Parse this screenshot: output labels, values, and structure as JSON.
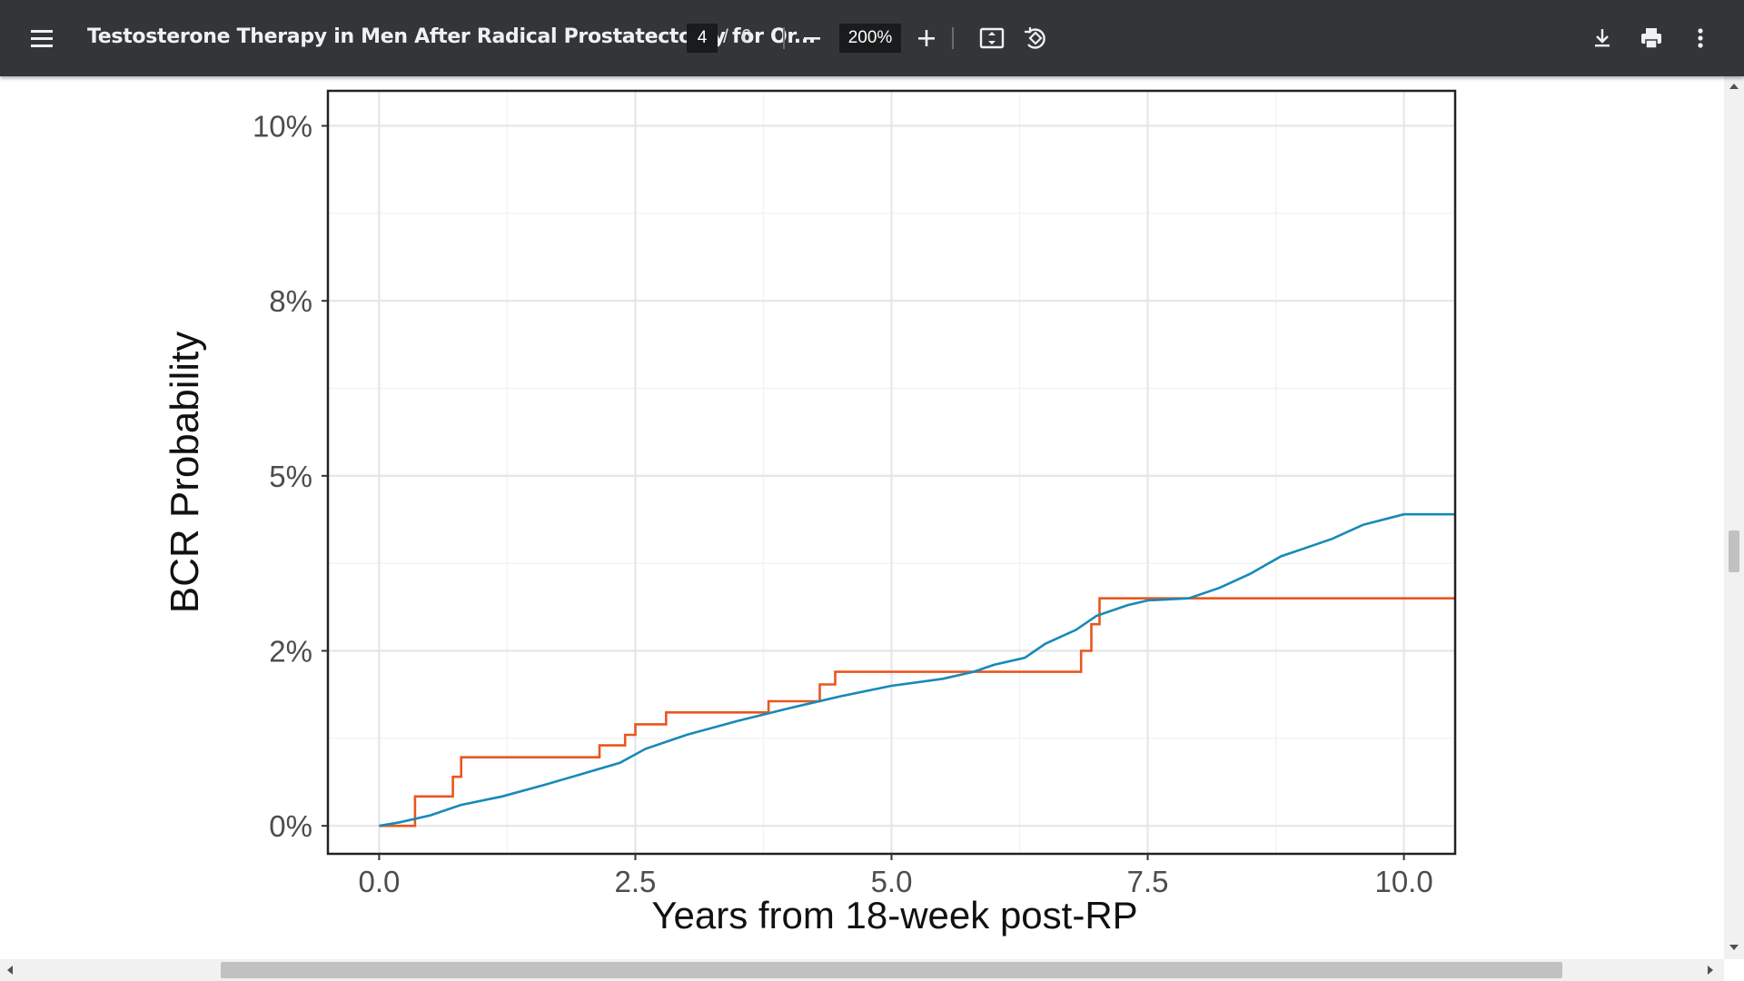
{
  "toolbar": {
    "menu_icon": "hamburger-menu-icon",
    "title": "Testosterone Therapy in Men After Radical Prostatectomy for Or...",
    "page_current": "4",
    "page_separator": "/",
    "page_total": "6",
    "zoom": "200%",
    "icons": [
      "zoom-out-icon",
      "zoom-in-icon",
      "fit-page-icon",
      "rotate-icon",
      "download-icon",
      "print-icon",
      "more-options-icon"
    ]
  },
  "chart_data": {
    "type": "line",
    "title": "",
    "xlabel": "Years from 18-week post-RP",
    "ylabel": "BCR Probability",
    "xlim": [
      -0.5,
      10.5
    ],
    "ylim": [
      -0.4,
      10.5
    ],
    "x_ticks": [
      0.0,
      2.5,
      5.0,
      7.5,
      10.0
    ],
    "x_tick_labels": [
      "0.0",
      "2.5",
      "5.0",
      "7.5",
      "10.0"
    ],
    "y_ticks": [
      0,
      2.5,
      5,
      7.5,
      10
    ],
    "y_tick_labels": [
      "0%",
      "2%",
      "5%",
      "8%",
      "10%"
    ],
    "grid": true,
    "legend": "none",
    "series": [
      {
        "color": "#e8571f",
        "step": true,
        "points": [
          [
            0,
            0
          ],
          [
            0.35,
            0
          ],
          [
            0.35,
            0.42
          ],
          [
            0.72,
            0.42
          ],
          [
            0.72,
            0.7
          ],
          [
            0.8,
            0.7
          ],
          [
            0.8,
            0.98
          ],
          [
            2.15,
            0.98
          ],
          [
            2.15,
            1.15
          ],
          [
            2.4,
            1.15
          ],
          [
            2.4,
            1.3
          ],
          [
            2.5,
            1.3
          ],
          [
            2.5,
            1.45
          ],
          [
            2.8,
            1.45
          ],
          [
            2.8,
            1.62
          ],
          [
            3.8,
            1.62
          ],
          [
            3.8,
            1.78
          ],
          [
            4.3,
            1.78
          ],
          [
            4.3,
            2.02
          ],
          [
            4.45,
            2.02
          ],
          [
            4.45,
            2.2
          ],
          [
            6.85,
            2.2
          ],
          [
            6.85,
            2.5
          ],
          [
            6.95,
            2.5
          ],
          [
            6.95,
            2.88
          ],
          [
            7.03,
            2.88
          ],
          [
            7.03,
            3.25
          ],
          [
            10.5,
            3.25
          ]
        ]
      },
      {
        "color": "#1789b8",
        "step": false,
        "points": [
          [
            0,
            0
          ],
          [
            0.2,
            0.05
          ],
          [
            0.5,
            0.15
          ],
          [
            0.8,
            0.3
          ],
          [
            1.2,
            0.42
          ],
          [
            1.6,
            0.58
          ],
          [
            2.0,
            0.75
          ],
          [
            2.35,
            0.9
          ],
          [
            2.6,
            1.1
          ],
          [
            3.0,
            1.3
          ],
          [
            3.5,
            1.5
          ],
          [
            4.0,
            1.68
          ],
          [
            4.5,
            1.85
          ],
          [
            5.0,
            2.0
          ],
          [
            5.5,
            2.1
          ],
          [
            5.8,
            2.2
          ],
          [
            6.0,
            2.3
          ],
          [
            6.3,
            2.4
          ],
          [
            6.5,
            2.6
          ],
          [
            6.8,
            2.8
          ],
          [
            7.0,
            3.0
          ],
          [
            7.3,
            3.15
          ],
          [
            7.5,
            3.22
          ],
          [
            7.9,
            3.25
          ],
          [
            8.2,
            3.4
          ],
          [
            8.5,
            3.6
          ],
          [
            8.8,
            3.85
          ],
          [
            9.0,
            3.95
          ],
          [
            9.3,
            4.1
          ],
          [
            9.6,
            4.3
          ],
          [
            10.0,
            4.45
          ],
          [
            10.5,
            4.45
          ]
        ]
      }
    ]
  }
}
